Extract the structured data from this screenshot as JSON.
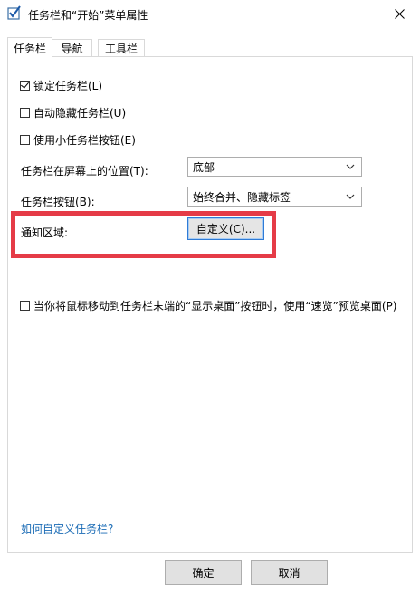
{
  "window": {
    "title": "任务栏和“开始”菜单属性",
    "app_icon": "checkbox-app-icon",
    "close_icon": "close-icon"
  },
  "tabs": [
    {
      "label": "任务栏",
      "active": true
    },
    {
      "label": "导航",
      "active": false
    },
    {
      "label": "工具栏",
      "active": false
    }
  ],
  "options": {
    "lock_taskbar": {
      "label": "锁定任务栏(L)",
      "checked": true
    },
    "auto_hide": {
      "label": "自动隐藏任务栏(U)",
      "checked": false
    },
    "small_buttons": {
      "label": "使用小任务栏按钮(E)",
      "checked": false
    }
  },
  "position": {
    "label": "任务栏在屏幕上的位置(T):",
    "value": "底部"
  },
  "buttons_setting": {
    "label": "任务栏按钮(B):",
    "value": "始终合并、隐藏标签"
  },
  "notification": {
    "label": "通知区域:",
    "button": "自定义(C)..."
  },
  "peek": {
    "label": "当你将鼠标移动到任务栏末端的“显示桌面”按钮时，使用“速览”预览桌面(P)",
    "checked": false
  },
  "help_link": "如何自定义任务栏?",
  "footer": {
    "ok": "确定",
    "cancel": "取消"
  },
  "colors": {
    "highlight_border": "#e53b47",
    "link": "#1a6bb5",
    "focus_border": "#2f7bd6"
  }
}
